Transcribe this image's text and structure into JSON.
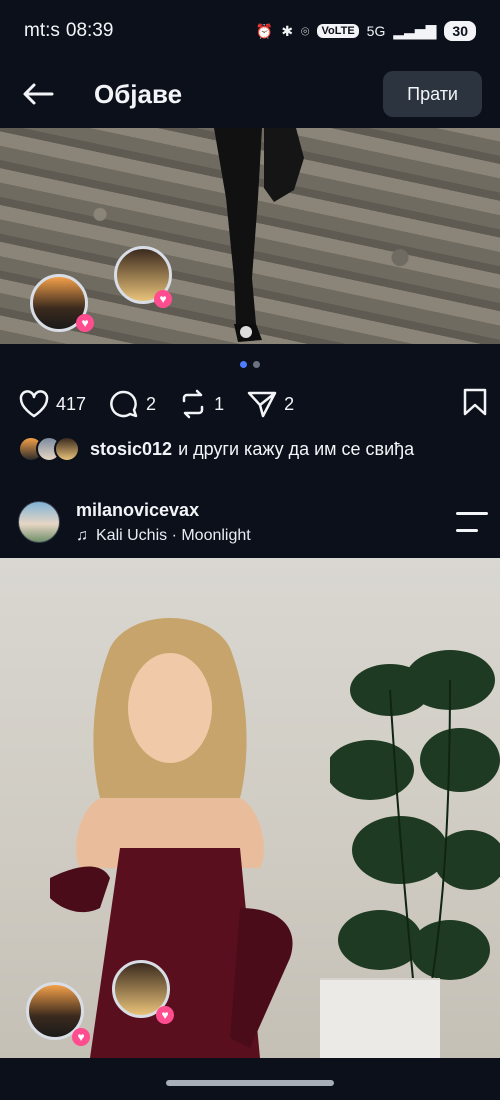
{
  "status": {
    "carrier": "mt:s",
    "time": "08:39",
    "volte": "VoLTE",
    "network": "5G",
    "battery": "30"
  },
  "header": {
    "title": "Објаве",
    "follow_label": "Прати"
  },
  "post1": {
    "likes": "417",
    "comments": "2",
    "reposts": "1",
    "shares": "2",
    "liked_by_user": "stosic012",
    "liked_by_text": "и други кажу да им се свиђа"
  },
  "post2": {
    "username": "milanovicevax",
    "music": "Kali Uchis · Moonlight"
  },
  "colors": {
    "accent_dot": "#4f7bff",
    "heart": "#ff4d8f"
  },
  "icons": [
    "back-arrow-icon",
    "heart-icon",
    "comment-icon",
    "repost-icon",
    "share-icon",
    "bookmark-icon",
    "music-note-icon",
    "menu-icon",
    "alarm-icon",
    "bluetooth-icon",
    "location-icon",
    "signal-icon"
  ]
}
